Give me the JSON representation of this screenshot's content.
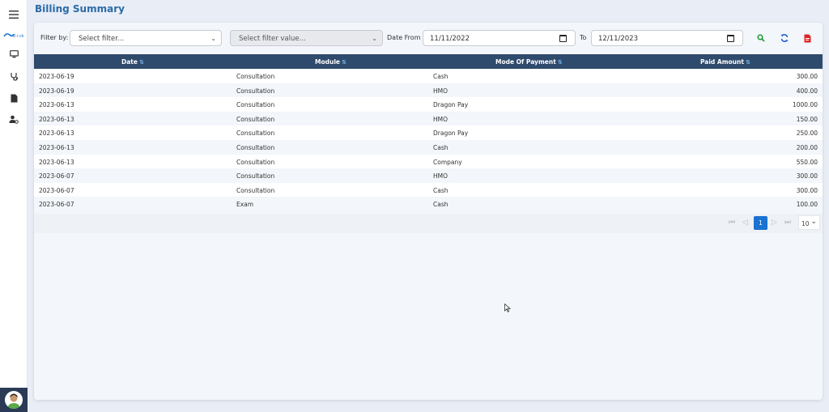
{
  "page": {
    "title": "Billing Summary"
  },
  "sidebar": {
    "icons": [
      "hamburger-menu-icon",
      "app-logo-icon",
      "monitor-icon",
      "stethoscope-icon",
      "document-icon",
      "user-settings-icon"
    ],
    "logo_text": "R·i·ck"
  },
  "filters": {
    "filter_by_label": "Filter by:",
    "filter_select_value": "Select filter...",
    "filter_value_value": "Select filter value...",
    "date_from_label": "Date From",
    "date_from_value": "11/11/2022",
    "to_label": "To",
    "date_to_value": "12/11/2023"
  },
  "toolbar": {
    "search_icon": "search-icon",
    "refresh_icon": "refresh-icon",
    "pdf_icon": "pdf-export-icon",
    "colors": {
      "search": "#1f9d3a",
      "refresh": "#1a5fd1",
      "pdf": "#e02424"
    }
  },
  "table": {
    "columns": [
      "Date",
      "Module",
      "Mode Of Payment",
      "Paid Amount"
    ],
    "sort_glyph": "⇅",
    "rows": [
      [
        "2023-06-19",
        "Consultation",
        "Cash",
        "300.00"
      ],
      [
        "2023-06-19",
        "Consultation",
        "HMO",
        "400.00"
      ],
      [
        "2023-06-13",
        "Consultation",
        "Dragon Pay",
        "1000.00"
      ],
      [
        "2023-06-13",
        "Consultation",
        "HMO",
        "150.00"
      ],
      [
        "2023-06-13",
        "Consultation",
        "Dragon Pay",
        "250.00"
      ],
      [
        "2023-06-13",
        "Consultation",
        "Cash",
        "200.00"
      ],
      [
        "2023-06-13",
        "Consultation",
        "Company",
        "550.00"
      ],
      [
        "2023-06-07",
        "Consultation",
        "HMO",
        "300.00"
      ],
      [
        "2023-06-07",
        "Consultation",
        "Cash",
        "300.00"
      ],
      [
        "2023-06-07",
        "Exam",
        "Cash",
        "100.00"
      ]
    ]
  },
  "pagination": {
    "first": "⏮",
    "prev": "◁",
    "current_page": "1",
    "next": "▷",
    "last": "⏭",
    "rows_per_page": "10"
  },
  "colors": {
    "accent": "#2b6aa6",
    "header": "#2e4a6d",
    "page_active": "#1a73d1"
  }
}
